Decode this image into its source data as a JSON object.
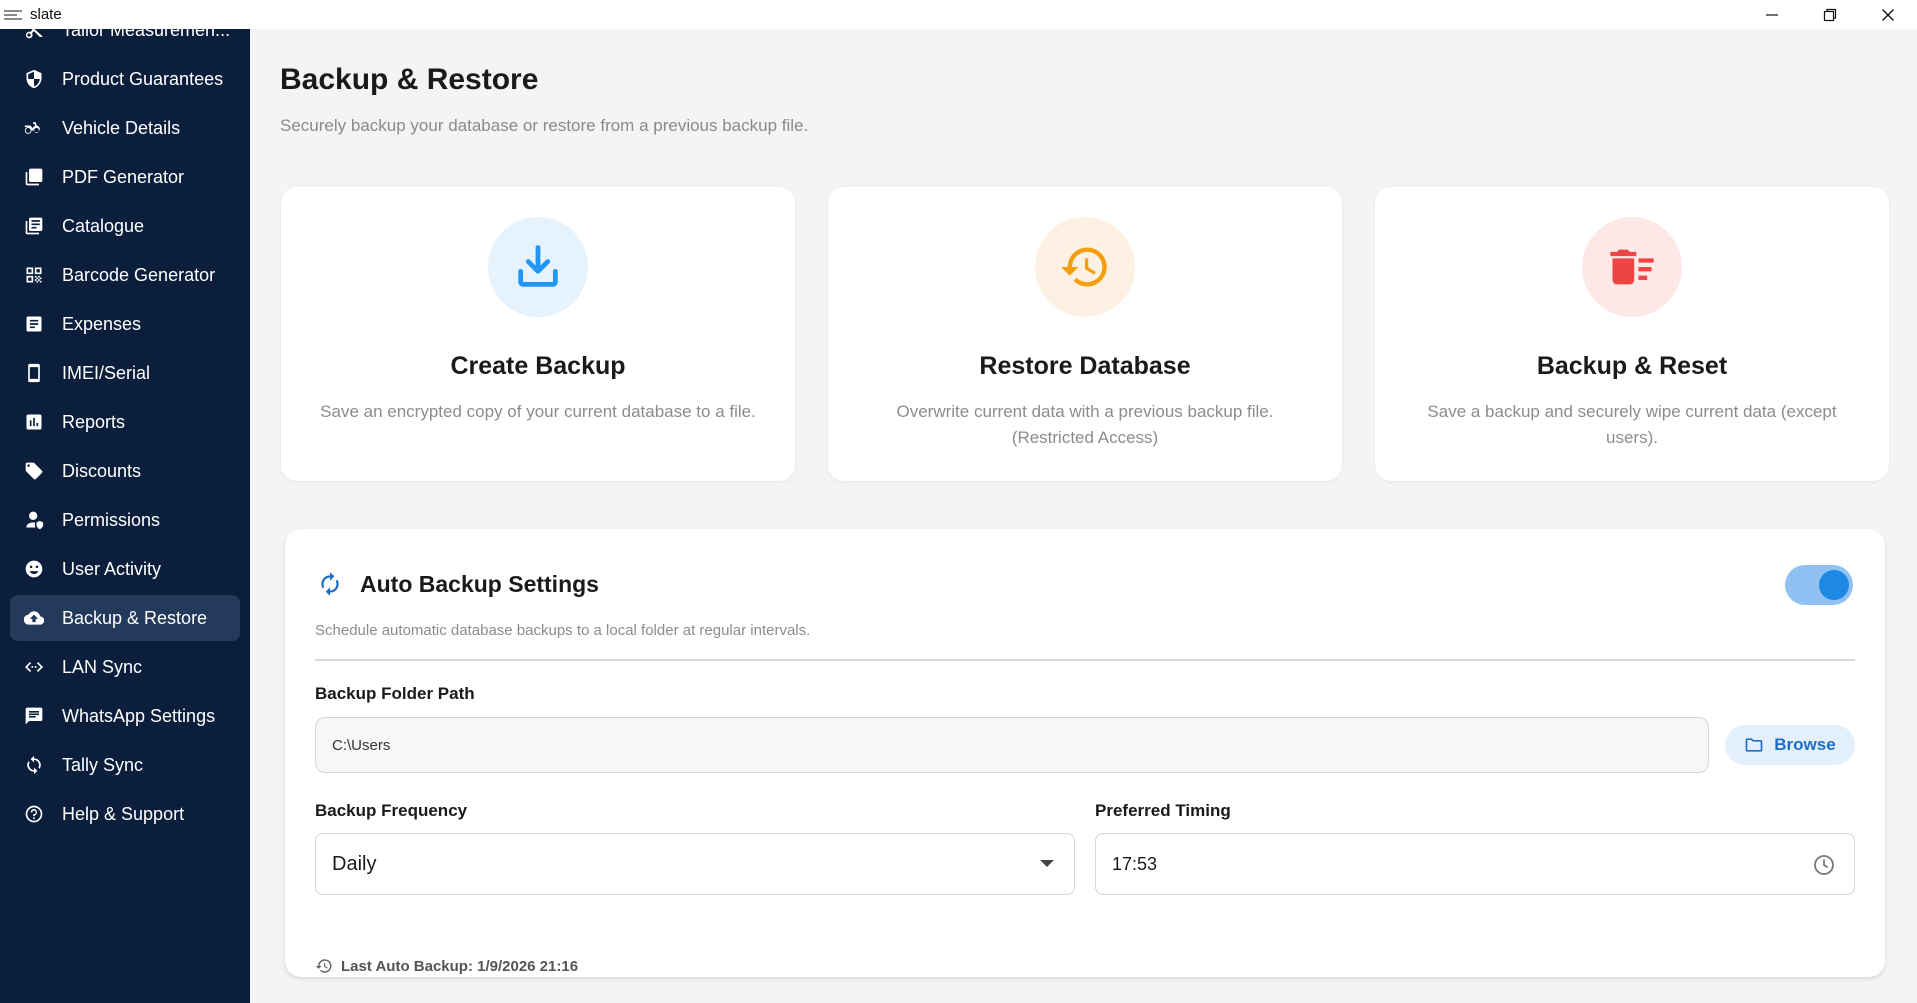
{
  "window": {
    "title": "slate",
    "controls": [
      "minimize",
      "maximize",
      "close"
    ]
  },
  "sidebar": {
    "items": [
      {
        "label": "Tailor Measuremen...",
        "icon": "scissors-icon"
      },
      {
        "label": "Product Guarantees",
        "icon": "shield-icon"
      },
      {
        "label": "Vehicle Details",
        "icon": "motorcycle-icon"
      },
      {
        "label": "PDF Generator",
        "icon": "pdf-icon"
      },
      {
        "label": "Catalogue",
        "icon": "catalogue-icon"
      },
      {
        "label": "Barcode Generator",
        "icon": "qr-code-icon"
      },
      {
        "label": "Expenses",
        "icon": "receipt-icon"
      },
      {
        "label": "IMEI/Serial",
        "icon": "phone-icon"
      },
      {
        "label": "Reports",
        "icon": "bar-chart-icon"
      },
      {
        "label": "Discounts",
        "icon": "tag-icon"
      },
      {
        "label": "Permissions",
        "icon": "user-shield-icon"
      },
      {
        "label": "User Activity",
        "icon": "face-icon"
      },
      {
        "label": "Backup & Restore",
        "icon": "cloud-upload-icon",
        "active": true
      },
      {
        "label": "LAN Sync",
        "icon": "code-arrows-icon"
      },
      {
        "label": "WhatsApp Settings",
        "icon": "message-icon"
      },
      {
        "label": "Tally Sync",
        "icon": "sync-icon"
      },
      {
        "label": "Help & Support",
        "icon": "help-icon"
      }
    ]
  },
  "header": {
    "title": "Backup & Restore",
    "subtitle": "Securely backup your database or restore from a previous backup file."
  },
  "cards": [
    {
      "title": "Create Backup",
      "description": "Save an encrypted copy of your current database to a file.",
      "icon": "download-icon",
      "color": "#2196f3",
      "bg": "#e6f2fc"
    },
    {
      "title": "Restore Database",
      "description": "Overwrite current data with a previous backup file. (Restricted Access)",
      "icon": "history-icon",
      "color": "#f59e0b",
      "bg": "#fdf1e3"
    },
    {
      "title": "Backup & Reset",
      "description": "Save a backup and securely wipe current data (except users).",
      "icon": "delete-sweep-icon",
      "color": "#ef4444",
      "bg": "#fde8e8"
    }
  ],
  "auto_backup": {
    "title": "Auto Backup Settings",
    "description": "Schedule automatic database backups to a local folder at regular intervals.",
    "enabled": true,
    "folder_label": "Backup Folder Path",
    "folder_value": "C:\\Users",
    "browse_label": "Browse",
    "frequency_label": "Backup Frequency",
    "frequency_value": "Daily",
    "timing_label": "Preferred Timing",
    "timing_value": "17:53",
    "last_backup": "Last Auto Backup: 1/9/2026 21:16"
  },
  "colors": {
    "sidebar_bg": "#0b1f3d",
    "sidebar_active": "#243a5a",
    "accent": "#1e88e5"
  }
}
